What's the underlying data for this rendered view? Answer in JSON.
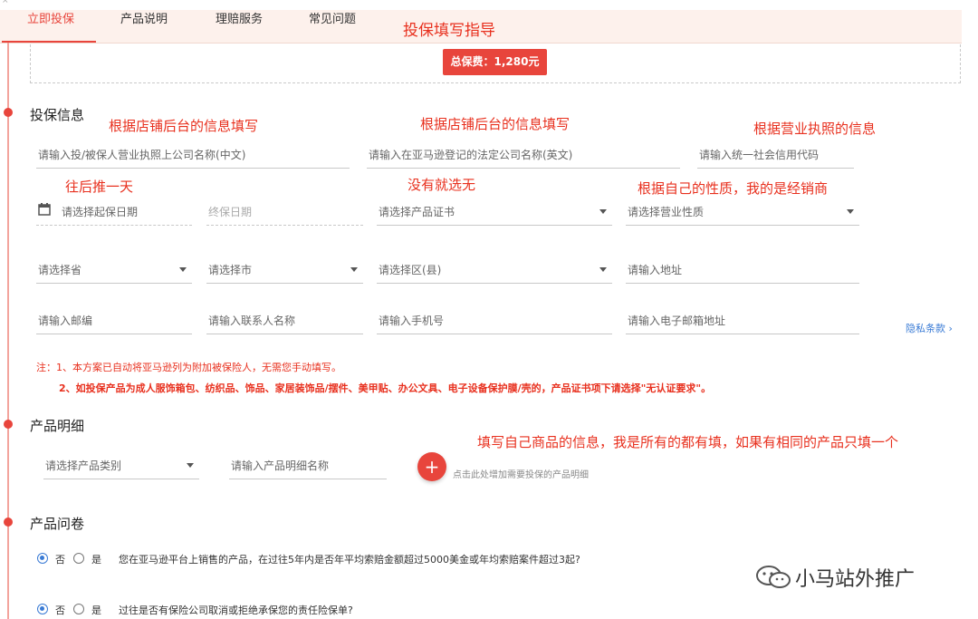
{
  "tabs": [
    {
      "label": "立即投保",
      "active": true
    },
    {
      "label": "产品说明",
      "active": false
    },
    {
      "label": "理赔服务",
      "active": false
    },
    {
      "label": "常见问题",
      "active": false
    }
  ],
  "guide_title": "投保填写指导",
  "premium_label": "总保费：1,280元",
  "insurance_info": {
    "title": "投保信息",
    "annotations": {
      "company_cn": "根据店铺后台的信息填写",
      "company_en": "根据店铺后台的信息填写",
      "credit_code": "根据营业执照的信息",
      "start_date": "往后推一天",
      "certificate": "没有就选无",
      "business_nature": "根据自己的性质，我的是经销商"
    },
    "placeholders": {
      "company_cn": "请输入投/被保人营业执照上公司名称(中文)",
      "company_en": "请输入在亚马逊登记的法定公司名称(英文)",
      "credit_code": "请输入统一社会信用代码",
      "start_date": "请选择起保日期",
      "end_date": "终保日期",
      "certificate": "请选择产品证书",
      "business_nature": "请选择营业性质",
      "province": "请选择省",
      "city": "请选择市",
      "district": "请选择区(县)",
      "address": "请输入地址",
      "postcode": "请输入邮编",
      "contact": "请输入联系人名称",
      "phone": "请输入手机号",
      "email": "请输入电子邮箱地址"
    },
    "privacy_link": "隐私条款 ›",
    "note1": "注：1、本方案已自动将亚马逊列为附加被保险人，无需您手动填写。",
    "note2": "2、如投保产品为成人服饰箱包、纺织品、饰品、家居装饰品/摆件、美甲贴、办公文具、电子设备保护膜/壳的，产品证书项下请选择\"无认证要求\"。"
  },
  "product_detail": {
    "title": "产品明细",
    "category_placeholder": "请选择产品类别",
    "name_placeholder": "请输入产品明细名称",
    "add_icon": "+",
    "add_hint": "点击此处增加需要投保的产品明细",
    "annotation": "填写自己商品的信息，我是所有的都有填，如果有相同的产品只填一个"
  },
  "questionnaire": {
    "title": "产品问卷",
    "questions": [
      {
        "no": "否",
        "yes": "是",
        "selected": "no",
        "text": "您在亚马逊平台上销售的产品，在过往5年内是否年平均索赔金额超过5000美金或年均索赔案件超过3起?"
      },
      {
        "no": "否",
        "yes": "是",
        "selected": "no",
        "text": "过往是否有保险公司取消或拒绝承保您的责任险保单?"
      }
    ]
  },
  "watermark": "小马站外推广",
  "colors": {
    "accent": "#e8453c",
    "annotation": "#e8301e",
    "link": "#3a7bd5"
  }
}
